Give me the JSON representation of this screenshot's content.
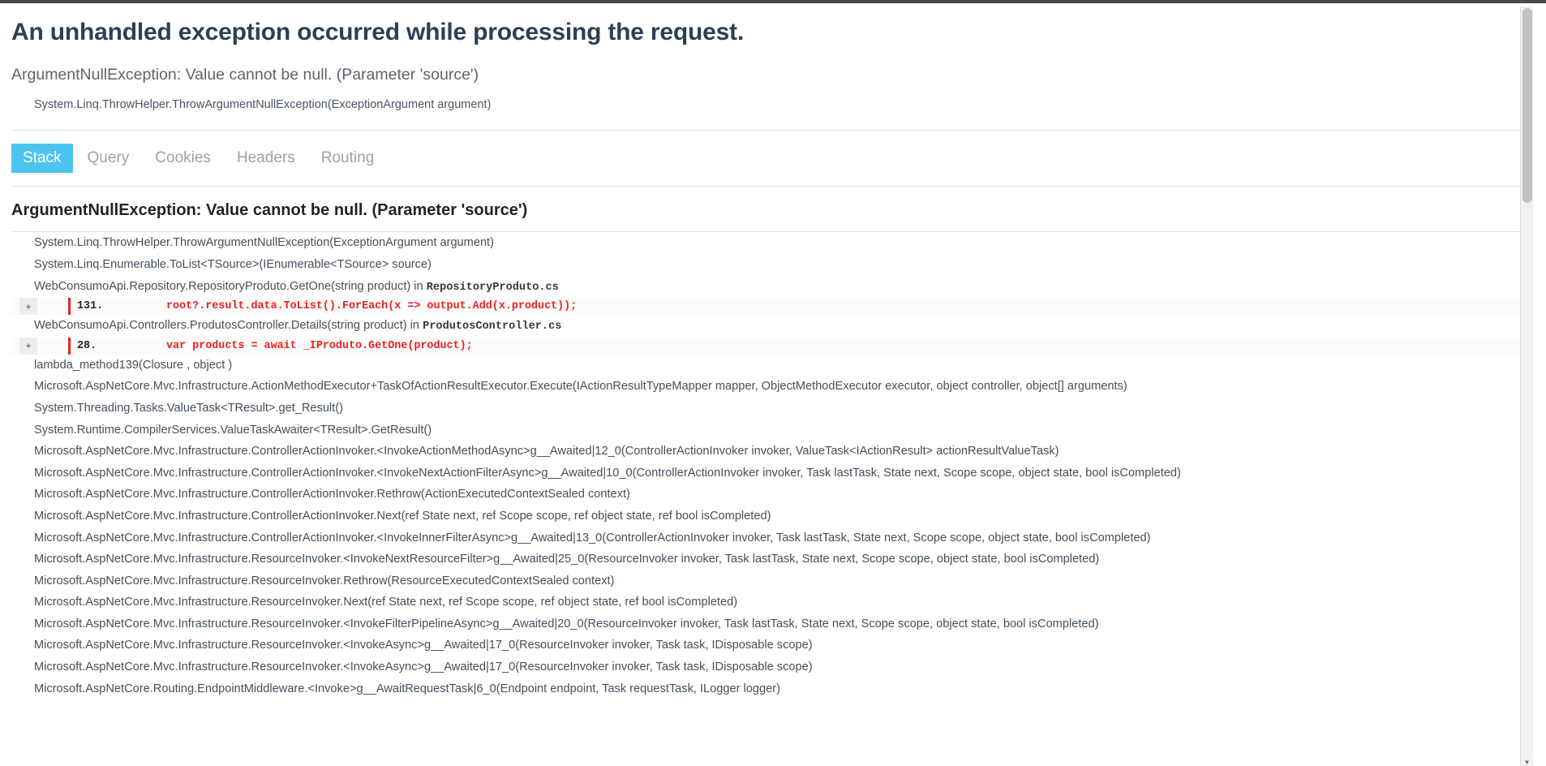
{
  "page": {
    "title": "An unhandled exception occurred while processing the request.",
    "exception_title": "ArgumentNullException: Value cannot be null. (Parameter 'source')",
    "exception_detail": "System.Linq.ThrowHelper.ThrowArgumentNullException(ExceptionArgument argument)"
  },
  "colors": {
    "active_tab_bg": "#4dc4f0",
    "title": "#2b4055",
    "code_red": "#ee1f1f",
    "code_bar": "#e42525",
    "code_bg": "#fbfbfb"
  },
  "tabs": [
    {
      "label": "Stack",
      "active": true
    },
    {
      "label": "Query",
      "active": false
    },
    {
      "label": "Cookies",
      "active": false
    },
    {
      "label": "Headers",
      "active": false
    },
    {
      "label": "Routing",
      "active": false
    }
  ],
  "stack": {
    "heading": "ArgumentNullException: Value cannot be null. (Parameter 'source')",
    "frames": [
      {
        "kind": "frame",
        "text": "System.Linq.ThrowHelper.ThrowArgumentNullException(ExceptionArgument argument)",
        "file": ""
      },
      {
        "kind": "frame",
        "text": "System.Linq.Enumerable.ToList<TSource>(IEnumerable<TSource> source)",
        "file": ""
      },
      {
        "kind": "frame",
        "text": "WebConsumoApi.Repository.RepositoryProduto.GetOne(string product) in ",
        "file": "RepositoryProduto.cs"
      },
      {
        "kind": "code",
        "expand": "+",
        "line": "131.",
        "code": "root?.result.data.ToList().ForEach(x => output.Add(x.product));"
      },
      {
        "kind": "frame",
        "text": "WebConsumoApi.Controllers.ProdutosController.Details(string product) in ",
        "file": "ProdutosController.cs"
      },
      {
        "kind": "code",
        "expand": "+",
        "line": "28.",
        "code": "var products = await _IProduto.GetOne(product);"
      },
      {
        "kind": "frame",
        "text": "lambda_method139(Closure , object )",
        "file": ""
      },
      {
        "kind": "frame",
        "text": "Microsoft.AspNetCore.Mvc.Infrastructure.ActionMethodExecutor+TaskOfActionResultExecutor.Execute(IActionResultTypeMapper mapper, ObjectMethodExecutor executor, object controller, object[] arguments)",
        "file": ""
      },
      {
        "kind": "frame",
        "text": "System.Threading.Tasks.ValueTask<TResult>.get_Result()",
        "file": ""
      },
      {
        "kind": "frame",
        "text": "System.Runtime.CompilerServices.ValueTaskAwaiter<TResult>.GetResult()",
        "file": ""
      },
      {
        "kind": "frame",
        "text": "Microsoft.AspNetCore.Mvc.Infrastructure.ControllerActionInvoker.<InvokeActionMethodAsync>g__Awaited|12_0(ControllerActionInvoker invoker, ValueTask<IActionResult> actionResultValueTask)",
        "file": ""
      },
      {
        "kind": "frame",
        "text": "Microsoft.AspNetCore.Mvc.Infrastructure.ControllerActionInvoker.<InvokeNextActionFilterAsync>g__Awaited|10_0(ControllerActionInvoker invoker, Task lastTask, State next, Scope scope, object state, bool isCompleted)",
        "file": ""
      },
      {
        "kind": "frame",
        "text": "Microsoft.AspNetCore.Mvc.Infrastructure.ControllerActionInvoker.Rethrow(ActionExecutedContextSealed context)",
        "file": ""
      },
      {
        "kind": "frame",
        "text": "Microsoft.AspNetCore.Mvc.Infrastructure.ControllerActionInvoker.Next(ref State next, ref Scope scope, ref object state, ref bool isCompleted)",
        "file": ""
      },
      {
        "kind": "frame",
        "text": "Microsoft.AspNetCore.Mvc.Infrastructure.ControllerActionInvoker.<InvokeInnerFilterAsync>g__Awaited|13_0(ControllerActionInvoker invoker, Task lastTask, State next, Scope scope, object state, bool isCompleted)",
        "file": ""
      },
      {
        "kind": "frame",
        "text": "Microsoft.AspNetCore.Mvc.Infrastructure.ResourceInvoker.<InvokeNextResourceFilter>g__Awaited|25_0(ResourceInvoker invoker, Task lastTask, State next, Scope scope, object state, bool isCompleted)",
        "file": ""
      },
      {
        "kind": "frame",
        "text": "Microsoft.AspNetCore.Mvc.Infrastructure.ResourceInvoker.Rethrow(ResourceExecutedContextSealed context)",
        "file": ""
      },
      {
        "kind": "frame",
        "text": "Microsoft.AspNetCore.Mvc.Infrastructure.ResourceInvoker.Next(ref State next, ref Scope scope, ref object state, ref bool isCompleted)",
        "file": ""
      },
      {
        "kind": "frame",
        "text": "Microsoft.AspNetCore.Mvc.Infrastructure.ResourceInvoker.<InvokeFilterPipelineAsync>g__Awaited|20_0(ResourceInvoker invoker, Task lastTask, State next, Scope scope, object state, bool isCompleted)",
        "file": ""
      },
      {
        "kind": "frame",
        "text": "Microsoft.AspNetCore.Mvc.Infrastructure.ResourceInvoker.<InvokeAsync>g__Awaited|17_0(ResourceInvoker invoker, Task task, IDisposable scope)",
        "file": ""
      },
      {
        "kind": "frame",
        "text": "Microsoft.AspNetCore.Mvc.Infrastructure.ResourceInvoker.<InvokeAsync>g__Awaited|17_0(ResourceInvoker invoker, Task task, IDisposable scope)",
        "file": ""
      },
      {
        "kind": "frame",
        "text": "Microsoft.AspNetCore.Routing.EndpointMiddleware.<Invoke>g__AwaitRequestTask|6_0(Endpoint endpoint, Task requestTask, ILogger logger)",
        "file": ""
      }
    ]
  },
  "scrollbar": {
    "up_arrow": "▲",
    "down_arrow": "▼"
  }
}
